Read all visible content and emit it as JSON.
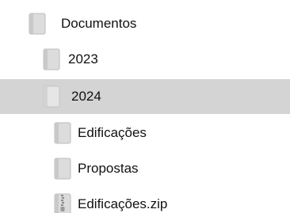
{
  "tree": {
    "items": [
      {
        "label": "Documentos",
        "icon": "folder-icon"
      },
      {
        "label": "2023",
        "icon": "folder-icon"
      },
      {
        "label": "2024",
        "icon": "folder-icon",
        "selected": true
      },
      {
        "label": "Edificações",
        "icon": "folder-icon"
      },
      {
        "label": "Propostas",
        "icon": "folder-icon"
      },
      {
        "label": "Edificações.zip",
        "icon": "zip-file-icon"
      }
    ]
  },
  "colors": {
    "selection_background": "#d4d4d4",
    "icon_fill": "#dcdcdc",
    "icon_stroke": "#b9b9b9",
    "text": "#111111"
  }
}
